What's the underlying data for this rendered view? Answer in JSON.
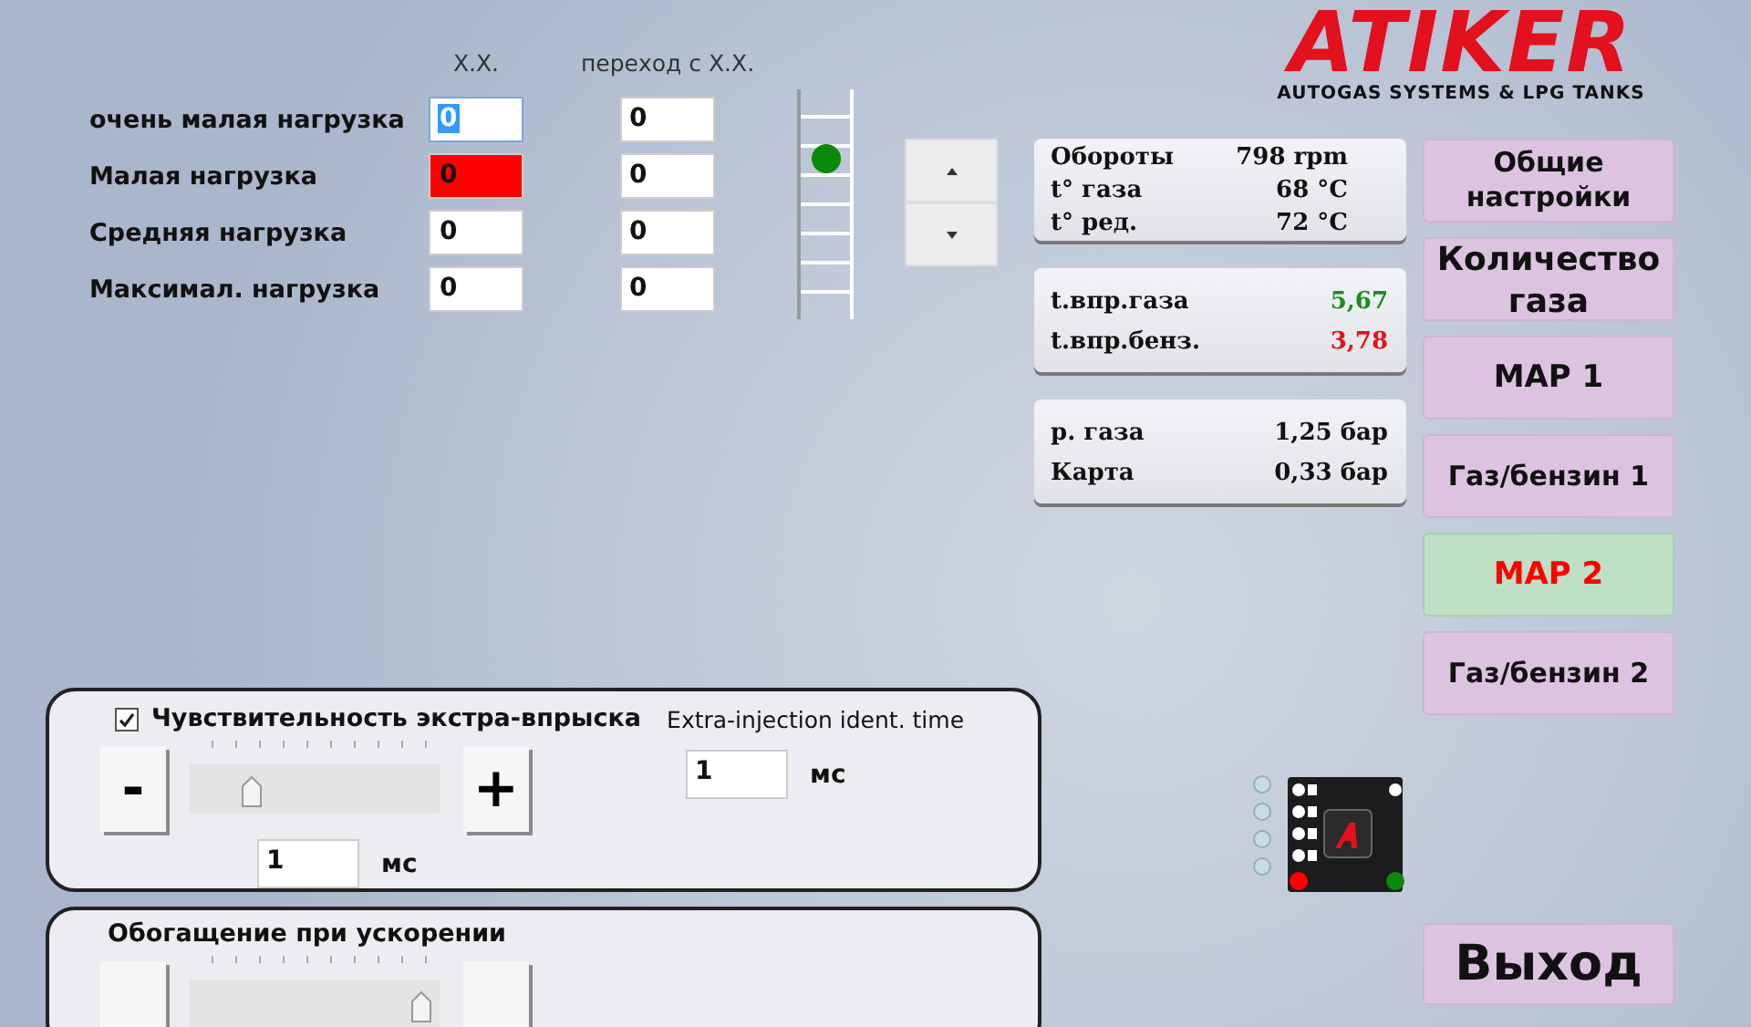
{
  "load_table": {
    "columns": [
      "Х.Х.",
      "переход с Х.Х."
    ],
    "rows": [
      {
        "label": "очень малая нагрузка",
        "idle": "0",
        "transition": "0",
        "active": false,
        "focused": true
      },
      {
        "label": "Малая нагрузка",
        "idle": "0",
        "transition": "0",
        "active": true,
        "focused": false
      },
      {
        "label": "Средняя нагрузка",
        "idle": "0",
        "transition": "0",
        "active": false,
        "focused": false
      },
      {
        "label": "Максимал. нагрузка",
        "idle": "0",
        "transition": "0",
        "active": false,
        "focused": false
      }
    ]
  },
  "load_indicator": {
    "level": 0.7
  },
  "logo": {
    "brand": "ATIKER",
    "tagline": "AUTOGAS SYSTEMS & LPG TANKS"
  },
  "info_panels": [
    {
      "rows": [
        {
          "label": "Обороты",
          "value": "798 rpm"
        },
        {
          "label": "t° газа",
          "value": "68 °C"
        },
        {
          "label": "t° ред.",
          "value": "72 °C"
        }
      ]
    },
    {
      "rows": [
        {
          "label": "t.впр.газа",
          "value": "5,67",
          "color": "#1e8c1e"
        },
        {
          "label": "t.впр.бенз.",
          "value": "3,78",
          "color": "#e8101a"
        }
      ]
    },
    {
      "rows": [
        {
          "label": "р. газа",
          "value": "1,25 бар"
        },
        {
          "label": "Карта",
          "value": "0,33 бар"
        }
      ]
    }
  ],
  "nav_buttons": [
    {
      "label": "Общие настройки",
      "selected": false
    },
    {
      "label": "Количество газа",
      "selected": false
    },
    {
      "label": "MAP 1",
      "selected": false
    },
    {
      "label": "Газ/бензин 1",
      "selected": false
    },
    {
      "label": "MAP 2",
      "selected": true
    },
    {
      "label": "Газ/бензин 2",
      "selected": false
    }
  ],
  "exit_button": {
    "label": "Выход"
  },
  "sensitivity_panel": {
    "checked": true,
    "title": "Чувствительность экстра-впрыска",
    "minus": "-",
    "plus": "+",
    "level": 0.25,
    "value": "1",
    "unit": "мс",
    "ident_label": "Extra-injection ident. time",
    "ident_value": "1",
    "ident_unit": "мс"
  },
  "enrichment_panel": {
    "title": "Обогащение при ускорении",
    "level": 0.97
  }
}
